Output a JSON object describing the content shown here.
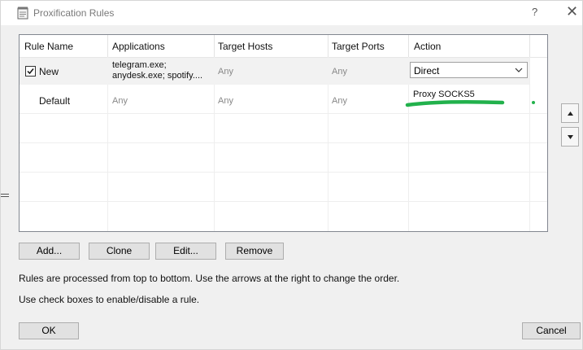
{
  "window": {
    "title": "Proxification Rules",
    "help_label": "?",
    "close_label": "✕"
  },
  "table": {
    "columns": [
      "Rule Name",
      "Applications",
      "Target Hosts",
      "Target Ports",
      "Action"
    ],
    "rows": [
      {
        "name": "New",
        "applications_line1": "telegram.exe;",
        "applications_line2": "anydesk.exe; spotify....",
        "target_hosts": "Any",
        "target_ports": "Any",
        "action": "Direct",
        "enabled": true,
        "selected": true
      },
      {
        "name": "Default",
        "applications": "Any",
        "target_hosts": "Any",
        "target_ports": "Any",
        "action": "Proxy SOCKS5"
      }
    ]
  },
  "buttons": {
    "add": "Add...",
    "clone": "Clone",
    "edit": "Edit...",
    "remove": "Remove",
    "ok": "OK",
    "cancel": "Cancel"
  },
  "notes": {
    "order": "Rules are processed from top to bottom. Use the arrows at the right to change the order.",
    "enable": "Use check boxes to enable/disable a rule."
  },
  "colors": {
    "redaction": "#22b14c",
    "selected_row": "#f2f2f2"
  },
  "icons": {
    "app": "notepad-icon",
    "move_up": "arrow-up-icon",
    "move_down": "arrow-down-icon"
  }
}
